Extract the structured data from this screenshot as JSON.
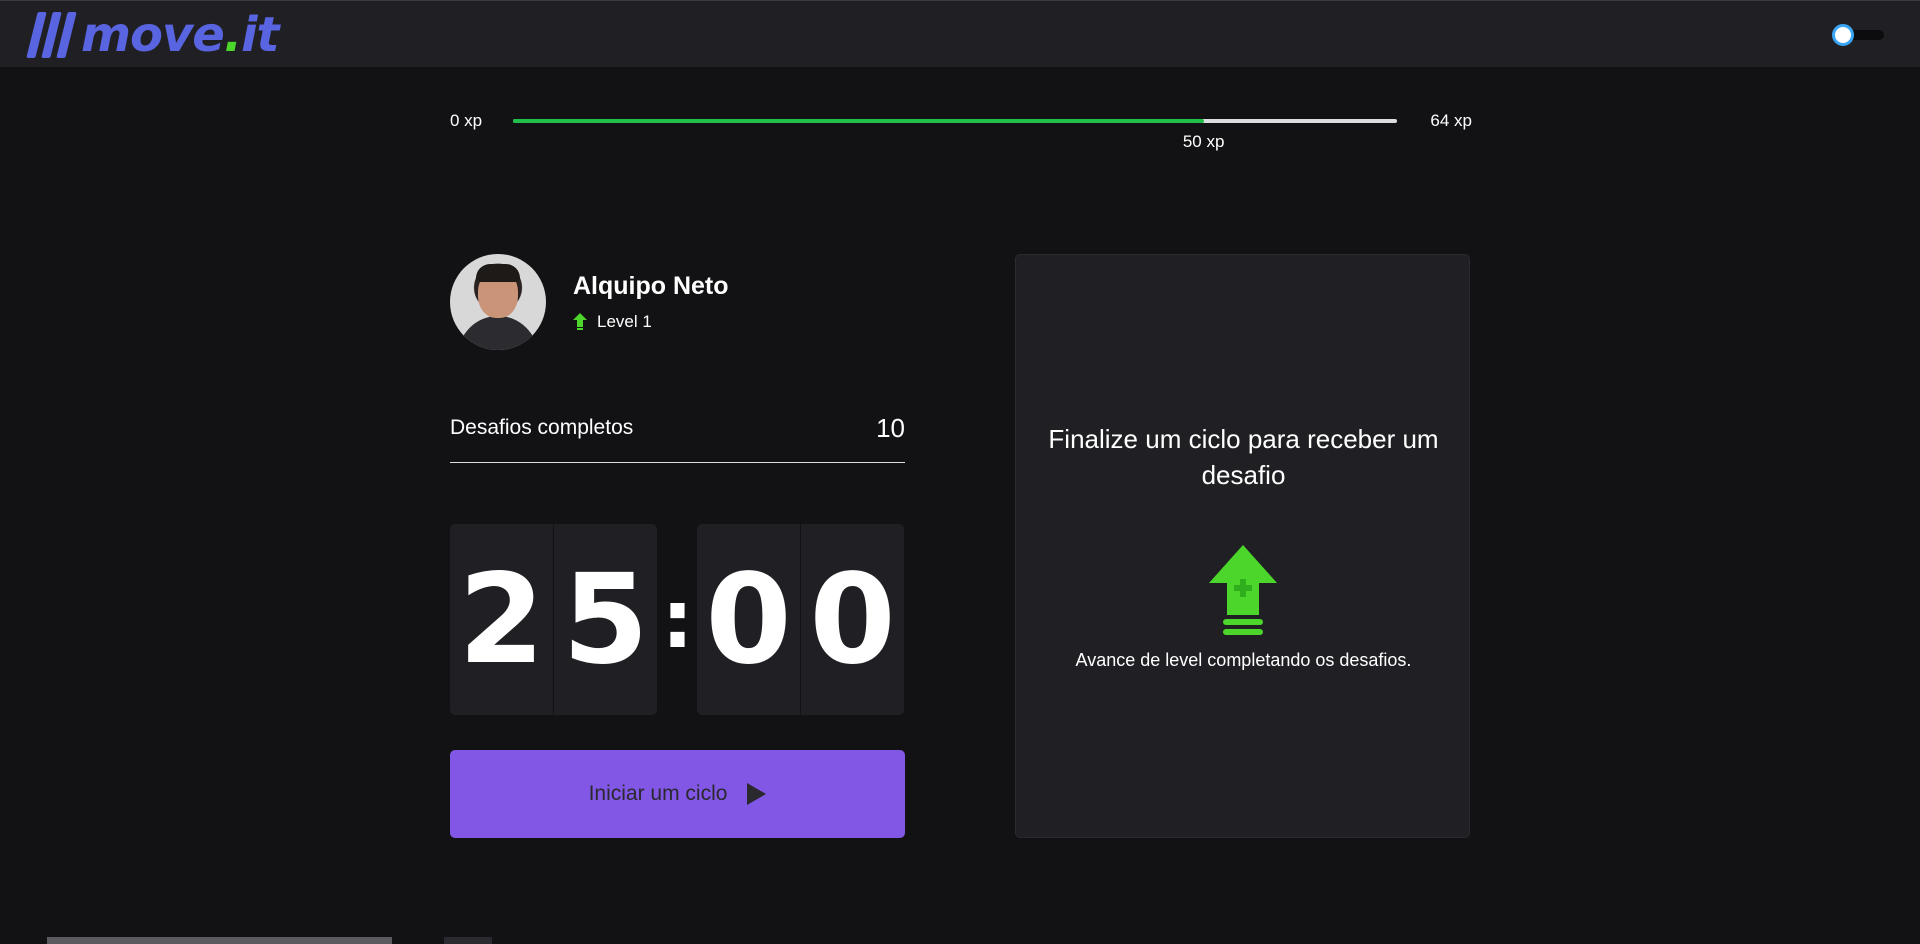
{
  "header": {
    "logo_text": "move",
    "logo_dot": ".",
    "logo_suffix": "it",
    "theme_toggle": {
      "icon": "toggle-switch-icon",
      "state": "off"
    }
  },
  "experience": {
    "min_label": "0 xp",
    "max_label": "64 xp",
    "current_label": "50 xp",
    "current_xp": 50,
    "max_xp": 64,
    "fill_color": "#1fbf4a"
  },
  "profile": {
    "name": "Alquipo Neto",
    "level_label": "Level 1",
    "avatar_icon": "user-avatar",
    "level_icon": "level-up-arrow-icon"
  },
  "completed_challenges": {
    "label": "Desafios completos",
    "count": "10"
  },
  "countdown": {
    "minute_left": "2",
    "minute_right": "5",
    "separator": ":",
    "second_left": "0",
    "second_right": "0"
  },
  "start_button": {
    "label": "Iniciar um ciclo",
    "icon": "play-icon",
    "color": "#8257e5"
  },
  "challenge_box": {
    "title": "Finalize um ciclo para receber um desafio",
    "hint": "Avance de level completando os desafios.",
    "icon": "level-up-arrow-icon",
    "icon_color": "#4cd62b"
  },
  "colors": {
    "background": "#121214",
    "panel": "#202024",
    "brand": "#5965e0"
  }
}
